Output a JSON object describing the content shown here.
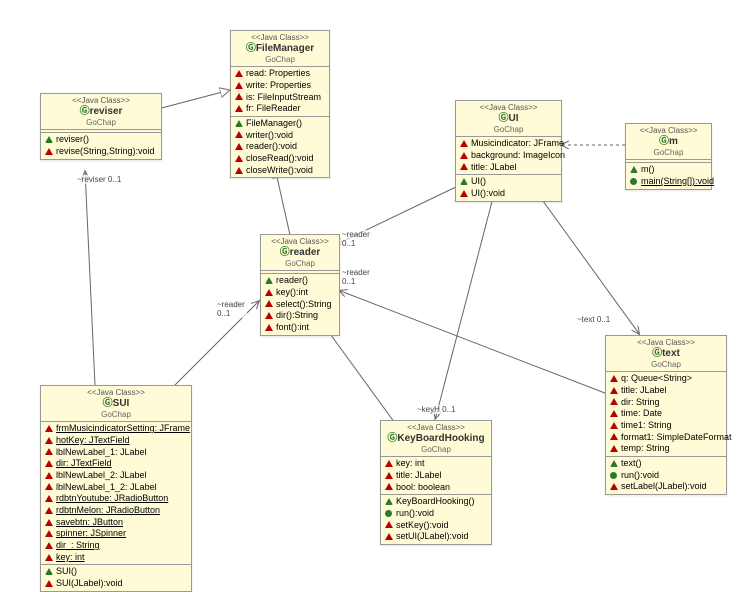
{
  "stereotype": "<<Java Class>>",
  "pkg": "GoChap",
  "classes": {
    "reviser": {
      "name": "reviser",
      "attrs": [],
      "ops": [
        "reviser()",
        "revise(String,String):void"
      ]
    },
    "FileManager": {
      "name": "FileManager",
      "attrs": [
        "read: Properties",
        "write: Properties",
        "is: FileInputStream",
        "fr: FileReader"
      ],
      "ops": [
        "FileManager()",
        "writer():void",
        "reader():void",
        "closeRead():void",
        "closeWrite():void"
      ]
    },
    "UI": {
      "name": "UI",
      "attrs": [
        "Musicindicator: JFrame",
        "background: ImageIcon",
        "title: JLabel"
      ],
      "ops": [
        "UI()",
        "UI():void"
      ]
    },
    "m": {
      "name": "m",
      "attrs": [],
      "ops": [
        "m()",
        "main(String[]):void"
      ]
    },
    "reader": {
      "name": "reader",
      "attrs": [],
      "ops": [
        "reader()",
        "key():int",
        "select():String",
        "dir():String",
        "font():int"
      ]
    },
    "SUI": {
      "name": "SUI",
      "attrs": [
        "frmMusicindicatorSetting: JFrame",
        "hotKey: JTextField",
        "lblNewLabel_1: JLabel",
        "dir: JTextField",
        "lblNewLabel_2: JLabel",
        "lblNewLabel_1_2: JLabel",
        "rdbtnYoutube: JRadioButton",
        "rdbtnMelon: JRadioButton",
        "savebtn: JButton",
        "spinner: JSpinner",
        "dir_: String",
        "key: int"
      ],
      "ops": [
        "SUI()",
        "SUI(JLabel):void"
      ]
    },
    "KeyBoardHooking": {
      "name": "KeyBoardHooking",
      "attrs": [
        "key: int",
        "title: JLabel",
        "bool: boolean"
      ],
      "ops": [
        "KeyBoardHooking()",
        "run():void",
        "setKey():void",
        "setUI(JLabel):void"
      ]
    },
    "text": {
      "name": "text",
      "attrs": [
        "q: Queue<String>",
        "title: JLabel",
        "dir: String",
        "time: Date",
        "time1: String",
        "format1: SimpleDateFormat",
        "temp: String"
      ],
      "ops": [
        "text()",
        "run():void",
        "setLabel(JLabel):void"
      ]
    }
  },
  "edgeLabels": {
    "reviserRole": "~reviser",
    "readerRole": "~reader",
    "textRole": "~text",
    "keyHRole": "~keyH",
    "mult01": "0..1"
  },
  "chart_data": {
    "type": "uml_class_diagram",
    "classes": [
      {
        "name": "reviser",
        "package": "GoChap",
        "methods": [
          "reviser()",
          "revise(String,String):void"
        ]
      },
      {
        "name": "FileManager",
        "package": "GoChap",
        "fields": [
          "read:Properties",
          "write:Properties",
          "is:FileInputStream",
          "fr:FileReader"
        ],
        "methods": [
          "FileManager()",
          "writer():void",
          "reader():void",
          "closeRead():void",
          "closeWrite():void"
        ]
      },
      {
        "name": "UI",
        "package": "GoChap",
        "fields": [
          "Musicindicator:JFrame",
          "background:ImageIcon",
          "title:JLabel"
        ],
        "methods": [
          "UI()",
          "UI():void"
        ]
      },
      {
        "name": "m",
        "package": "GoChap",
        "methods": [
          "m()",
          "main(String[]):void"
        ]
      },
      {
        "name": "reader",
        "package": "GoChap",
        "methods": [
          "reader()",
          "key():int",
          "select():String",
          "dir():String",
          "font():int"
        ]
      },
      {
        "name": "SUI",
        "package": "GoChap",
        "fields": [
          "frmMusicindicatorSetting:JFrame",
          "hotKey:JTextField",
          "lblNewLabel_1:JLabel",
          "dir:JTextField",
          "lblNewLabel_2:JLabel",
          "lblNewLabel_1_2:JLabel",
          "rdbtnYoutube:JRadioButton",
          "rdbtnMelon:JRadioButton",
          "savebtn:JButton",
          "spinner:JSpinner",
          "dir_:String",
          "key:int"
        ],
        "methods": [
          "SUI()",
          "SUI(JLabel):void"
        ]
      },
      {
        "name": "KeyBoardHooking",
        "package": "GoChap",
        "fields": [
          "key:int",
          "title:JLabel",
          "bool:boolean"
        ],
        "methods": [
          "KeyBoardHooking()",
          "run():void",
          "setKey():void",
          "setUI(JLabel):void"
        ]
      },
      {
        "name": "text",
        "package": "GoChap",
        "fields": [
          "q:Queue<String>",
          "title:JLabel",
          "dir:String",
          "time:Date",
          "time1:String",
          "format1:SimpleDateFormat",
          "temp:String"
        ],
        "methods": [
          "text()",
          "run():void",
          "setLabel(JLabel):void"
        ]
      }
    ],
    "relations": [
      {
        "from": "reviser",
        "to": "FileManager",
        "type": "generalization"
      },
      {
        "from": "reader",
        "to": "FileManager",
        "type": "generalization"
      },
      {
        "from": "SUI",
        "to": "reviser",
        "role": "~reviser",
        "mult": "0..1",
        "type": "association"
      },
      {
        "from": "SUI",
        "to": "reader",
        "role": "~reader",
        "mult": "0..1",
        "type": "association"
      },
      {
        "from": "UI",
        "to": "reader",
        "role": "~reader",
        "mult": "0..1",
        "type": "association"
      },
      {
        "from": "text",
        "to": "reader",
        "role": "~reader",
        "mult": "0..1",
        "type": "association"
      },
      {
        "from": "KeyBoardHooking",
        "to": "reader",
        "role": "~reader",
        "mult": "0..1",
        "type": "association"
      },
      {
        "from": "UI",
        "to": "text",
        "role": "~text",
        "mult": "0..1",
        "type": "association"
      },
      {
        "from": "UI",
        "to": "KeyBoardHooking",
        "role": "~keyH",
        "mult": "0..1",
        "type": "association"
      },
      {
        "from": "m",
        "to": "UI",
        "type": "dependency"
      }
    ]
  }
}
